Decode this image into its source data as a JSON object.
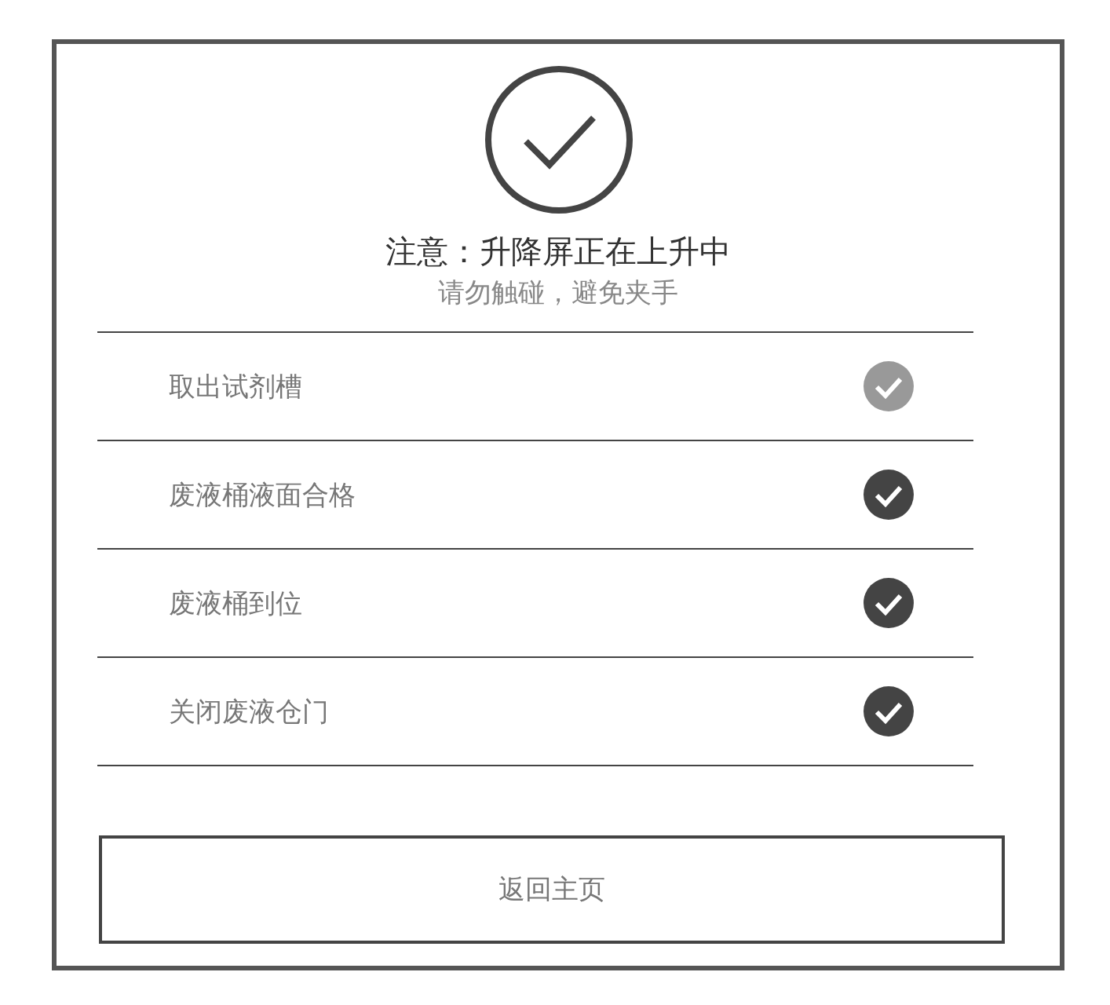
{
  "title": "注意：升降屏正在上升中",
  "subtitle": "请勿触碰，避免夹手",
  "items": [
    {
      "label": "取出试剂槽",
      "color": "#999999"
    },
    {
      "label": "废液桶液面合格",
      "color": "#444444"
    },
    {
      "label": "废液桶到位",
      "color": "#444444"
    },
    {
      "label": "关闭废液仓门",
      "color": "#444444"
    }
  ],
  "button": "返回主页"
}
